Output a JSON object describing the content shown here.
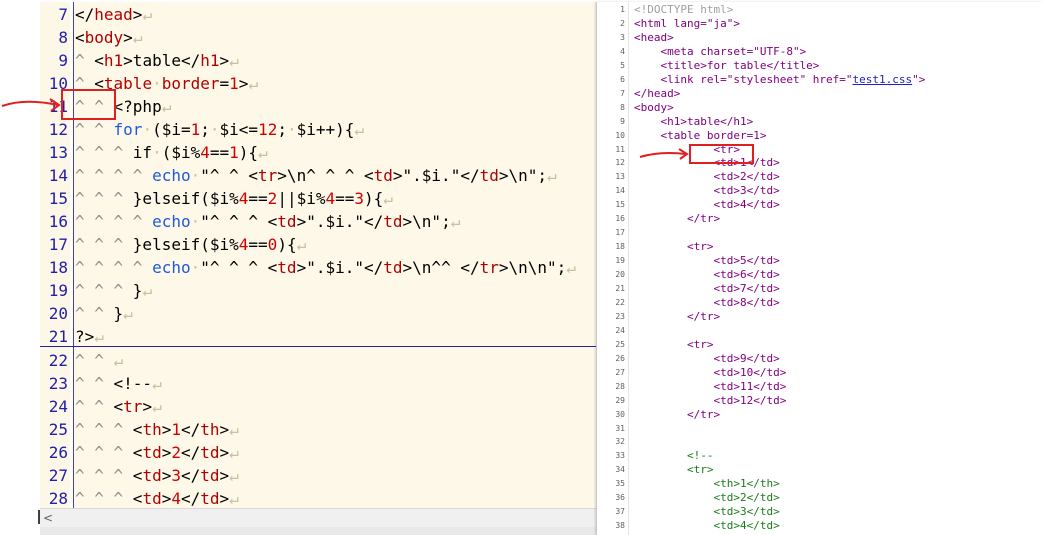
{
  "left_editor": {
    "lines": [
      {
        "n": "7",
        "parts": [
          [
            "t-str",
            "</"
          ],
          [
            "t-tag",
            "head"
          ],
          [
            "t-str",
            ">"
          ],
          [
            "t-mark",
            "↵"
          ]
        ]
      },
      {
        "n": "8",
        "parts": [
          [
            "t-str",
            "<"
          ],
          [
            "t-tag",
            "body"
          ],
          [
            "t-str",
            ">"
          ],
          [
            "t-mark",
            "↵"
          ]
        ]
      },
      {
        "n": "9",
        "parts": [
          [
            "t-dim",
            "^ "
          ],
          [
            "t-str",
            "<"
          ],
          [
            "t-tag",
            "h1"
          ],
          [
            "t-str",
            ">table</"
          ],
          [
            "t-tag",
            "h1"
          ],
          [
            "t-str",
            ">"
          ],
          [
            "t-mark",
            "↵"
          ]
        ]
      },
      {
        "n": "10",
        "parts": [
          [
            "t-dim",
            "^ "
          ],
          [
            "t-str",
            "<"
          ],
          [
            "t-tag",
            "table"
          ],
          [
            "t-mark",
            "·"
          ],
          [
            "t-tag",
            "border"
          ],
          [
            "t-str",
            "="
          ],
          [
            "t-num",
            "1"
          ],
          [
            "t-str",
            ">"
          ],
          [
            "t-mark",
            "↵"
          ]
        ]
      },
      {
        "n": "11",
        "parts": [
          [
            "t-dim",
            "^ ^ "
          ],
          [
            "t-str",
            "<?php"
          ],
          [
            "t-mark",
            "↵"
          ]
        ]
      },
      {
        "n": "12",
        "parts": [
          [
            "t-dim",
            "^ ^ "
          ],
          [
            "t-kw",
            "for"
          ],
          [
            "t-mark",
            "·"
          ],
          [
            "t-str",
            "($i="
          ],
          [
            "t-num",
            "1"
          ],
          [
            "t-str",
            ";"
          ],
          [
            "t-mark",
            "·"
          ],
          [
            "t-str",
            "$i<="
          ],
          [
            "t-num",
            "12"
          ],
          [
            "t-str",
            ";"
          ],
          [
            "t-mark",
            "·"
          ],
          [
            "t-str",
            "$i++){"
          ],
          [
            "t-mark",
            "↵"
          ]
        ]
      },
      {
        "n": "13",
        "parts": [
          [
            "t-dim",
            "^ ^ ^ "
          ],
          [
            "t-str",
            "if"
          ],
          [
            "t-mark",
            "·"
          ],
          [
            "t-str",
            "($i%"
          ],
          [
            "t-num",
            "4"
          ],
          [
            "t-str",
            "=="
          ],
          [
            "t-num",
            "1"
          ],
          [
            "t-str",
            "){"
          ],
          [
            "t-mark",
            "↵"
          ]
        ]
      },
      {
        "n": "14",
        "parts": [
          [
            "t-dim",
            "^ ^ ^ ^ "
          ],
          [
            "t-kw",
            "echo"
          ],
          [
            "t-mark",
            "·"
          ],
          [
            "t-str",
            "\"^ ^ <"
          ],
          [
            "t-tag",
            "tr"
          ],
          [
            "t-str",
            ">\\n^ ^ ^ <"
          ],
          [
            "t-tag",
            "td"
          ],
          [
            "t-str",
            ">\".$i.\"</"
          ],
          [
            "t-tag",
            "td"
          ],
          [
            "t-str",
            ">\\n\";"
          ],
          [
            "t-mark",
            "↵"
          ]
        ]
      },
      {
        "n": "15",
        "parts": [
          [
            "t-dim",
            "^ ^ ^ "
          ],
          [
            "t-str",
            "}elseif($i%"
          ],
          [
            "t-num",
            "4"
          ],
          [
            "t-str",
            "=="
          ],
          [
            "t-num",
            "2"
          ],
          [
            "t-str",
            "||$i%"
          ],
          [
            "t-num",
            "4"
          ],
          [
            "t-str",
            "=="
          ],
          [
            "t-num",
            "3"
          ],
          [
            "t-str",
            "){"
          ],
          [
            "t-mark",
            "↵"
          ]
        ]
      },
      {
        "n": "16",
        "parts": [
          [
            "t-dim",
            "^ ^ ^ ^ "
          ],
          [
            "t-kw",
            "echo"
          ],
          [
            "t-mark",
            "·"
          ],
          [
            "t-str",
            "\"^ ^ ^ <"
          ],
          [
            "t-tag",
            "td"
          ],
          [
            "t-str",
            ">\".$i.\"</"
          ],
          [
            "t-tag",
            "td"
          ],
          [
            "t-str",
            ">\\n\";"
          ],
          [
            "t-mark",
            "↵"
          ]
        ]
      },
      {
        "n": "17",
        "parts": [
          [
            "t-dim",
            "^ ^ ^ "
          ],
          [
            "t-str",
            "}elseif($i%"
          ],
          [
            "t-num",
            "4"
          ],
          [
            "t-str",
            "=="
          ],
          [
            "t-num",
            "0"
          ],
          [
            "t-str",
            "){"
          ],
          [
            "t-mark",
            "↵"
          ]
        ]
      },
      {
        "n": "18",
        "parts": [
          [
            "t-dim",
            "^ ^ ^ ^ "
          ],
          [
            "t-kw",
            "echo"
          ],
          [
            "t-mark",
            "·"
          ],
          [
            "t-str",
            "\"^ ^ ^ <"
          ],
          [
            "t-tag",
            "td"
          ],
          [
            "t-str",
            ">\".$i.\"</"
          ],
          [
            "t-tag",
            "td"
          ],
          [
            "t-str",
            ">\\n^^ </"
          ],
          [
            "t-tag",
            "tr"
          ],
          [
            "t-str",
            ">\\n\\n\";"
          ],
          [
            "t-mark",
            "↵"
          ]
        ]
      },
      {
        "n": "19",
        "parts": [
          [
            "t-dim",
            "^ ^ ^ "
          ],
          [
            "t-str",
            "}"
          ],
          [
            "t-mark",
            "↵"
          ]
        ]
      },
      {
        "n": "20",
        "parts": [
          [
            "t-dim",
            "^ ^ "
          ],
          [
            "t-str",
            "}"
          ],
          [
            "t-mark",
            "↵"
          ]
        ]
      },
      {
        "n": "21",
        "parts": [
          [
            "t-str",
            "?>"
          ],
          [
            "t-mark",
            "↵"
          ]
        ]
      },
      {
        "n": "22",
        "parts": [
          [
            "t-dim",
            "^ ^ "
          ],
          [
            "t-mark",
            "↵"
          ]
        ]
      },
      {
        "n": "23",
        "parts": [
          [
            "t-dim",
            "^ ^ "
          ],
          [
            "t-str",
            "<!--"
          ],
          [
            "t-mark",
            "↵"
          ]
        ]
      },
      {
        "n": "24",
        "parts": [
          [
            "t-dim",
            "^ ^ "
          ],
          [
            "t-str",
            "<"
          ],
          [
            "t-tag",
            "tr"
          ],
          [
            "t-str",
            ">"
          ],
          [
            "t-mark",
            "↵"
          ]
        ]
      },
      {
        "n": "25",
        "parts": [
          [
            "t-dim",
            "^ ^ ^ "
          ],
          [
            "t-str",
            "<"
          ],
          [
            "t-tag",
            "th"
          ],
          [
            "t-str",
            ">"
          ],
          [
            "t-num",
            "1"
          ],
          [
            "t-str",
            "</"
          ],
          [
            "t-tag",
            "th"
          ],
          [
            "t-str",
            ">"
          ],
          [
            "t-mark",
            "↵"
          ]
        ]
      },
      {
        "n": "26",
        "parts": [
          [
            "t-dim",
            "^ ^ ^ "
          ],
          [
            "t-str",
            "<"
          ],
          [
            "t-tag",
            "td"
          ],
          [
            "t-str",
            ">"
          ],
          [
            "t-num",
            "2"
          ],
          [
            "t-str",
            "</"
          ],
          [
            "t-tag",
            "td"
          ],
          [
            "t-str",
            ">"
          ],
          [
            "t-mark",
            "↵"
          ]
        ]
      },
      {
        "n": "27",
        "parts": [
          [
            "t-dim",
            "^ ^ ^ "
          ],
          [
            "t-str",
            "<"
          ],
          [
            "t-tag",
            "td"
          ],
          [
            "t-str",
            ">"
          ],
          [
            "t-num",
            "3"
          ],
          [
            "t-str",
            "</"
          ],
          [
            "t-tag",
            "td"
          ],
          [
            "t-str",
            ">"
          ],
          [
            "t-mark",
            "↵"
          ]
        ]
      },
      {
        "n": "28",
        "parts": [
          [
            "t-dim",
            "^ ^ ^ "
          ],
          [
            "t-str",
            "<"
          ],
          [
            "t-tag",
            "td"
          ],
          [
            "t-str",
            ">"
          ],
          [
            "t-num",
            "4"
          ],
          [
            "t-str",
            "</"
          ],
          [
            "t-tag",
            "td"
          ],
          [
            "t-str",
            ">"
          ],
          [
            "t-mark",
            "↵"
          ]
        ]
      }
    ],
    "scroll_left_glyph": "<"
  },
  "right_editor": {
    "lines": [
      {
        "n": "1",
        "cls": "dim",
        "text": "<!DOCTYPE html>"
      },
      {
        "n": "2",
        "cls": "",
        "text": "<html lang=\"ja\">"
      },
      {
        "n": "3",
        "cls": "",
        "text": "<head>"
      },
      {
        "n": "4",
        "cls": "",
        "text": "    <meta charset=\"UTF-8\">"
      },
      {
        "n": "5",
        "cls": "",
        "text": "    <title>for table</title>"
      },
      {
        "n": "6",
        "cls": "",
        "text": "    <link rel=\"stylesheet\" href=\"",
        "link": "test1.css",
        "tail": "\">"
      },
      {
        "n": "7",
        "cls": "",
        "text": "</head>"
      },
      {
        "n": "8",
        "cls": "",
        "text": "<body>"
      },
      {
        "n": "9",
        "cls": "",
        "text": "    <h1>table</h1>"
      },
      {
        "n": "10",
        "cls": "",
        "text": "    <table border=1>"
      },
      {
        "n": "11",
        "cls": "",
        "text": "            <tr>"
      },
      {
        "n": "12",
        "cls": "",
        "text": "            <td>1</td>"
      },
      {
        "n": "13",
        "cls": "",
        "text": "            <td>2</td>"
      },
      {
        "n": "14",
        "cls": "",
        "text": "            <td>3</td>"
      },
      {
        "n": "15",
        "cls": "",
        "text": "            <td>4</td>"
      },
      {
        "n": "16",
        "cls": "",
        "text": "        </tr>"
      },
      {
        "n": "17",
        "cls": "",
        "text": ""
      },
      {
        "n": "18",
        "cls": "",
        "text": "        <tr>"
      },
      {
        "n": "19",
        "cls": "",
        "text": "            <td>5</td>"
      },
      {
        "n": "20",
        "cls": "",
        "text": "            <td>6</td>"
      },
      {
        "n": "21",
        "cls": "",
        "text": "            <td>7</td>"
      },
      {
        "n": "22",
        "cls": "",
        "text": "            <td>8</td>"
      },
      {
        "n": "23",
        "cls": "",
        "text": "        </tr>"
      },
      {
        "n": "24",
        "cls": "",
        "text": ""
      },
      {
        "n": "25",
        "cls": "",
        "text": "        <tr>"
      },
      {
        "n": "26",
        "cls": "",
        "text": "            <td>9</td>"
      },
      {
        "n": "27",
        "cls": "",
        "text": "            <td>10</td>"
      },
      {
        "n": "28",
        "cls": "",
        "text": "            <td>11</td>"
      },
      {
        "n": "29",
        "cls": "",
        "text": "            <td>12</td>"
      },
      {
        "n": "30",
        "cls": "",
        "text": "        </tr>"
      },
      {
        "n": "31",
        "cls": "",
        "text": ""
      },
      {
        "n": "32",
        "cls": "",
        "text": ""
      },
      {
        "n": "33",
        "cls": "green",
        "text": "        <!--"
      },
      {
        "n": "34",
        "cls": "green",
        "text": "        <tr>"
      },
      {
        "n": "35",
        "cls": "green",
        "text": "            <th>1</th>"
      },
      {
        "n": "36",
        "cls": "green",
        "text": "            <td>2</td>"
      },
      {
        "n": "37",
        "cls": "green",
        "text": "            <td>3</td>"
      },
      {
        "n": "38",
        "cls": "green",
        "text": "            <td>4</td>"
      }
    ]
  },
  "annotations": {
    "highlight_color": "#e02020"
  }
}
